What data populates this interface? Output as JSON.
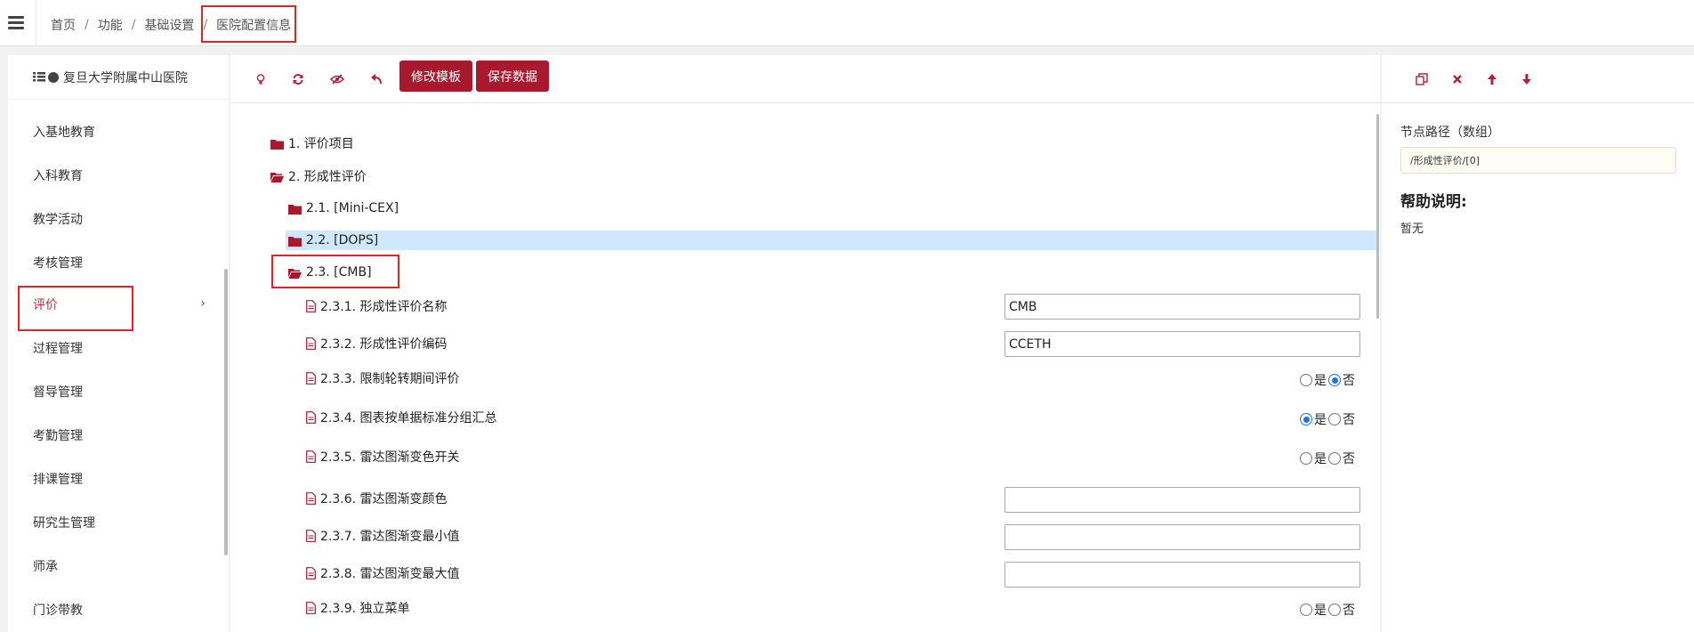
{
  "breadcrumb": {
    "home": "首页",
    "func": "功能",
    "basic": "基础设置",
    "current": "医院配置信息",
    "separator": "/"
  },
  "sidebar": {
    "hospital_name": "复旦大学附属中山医院",
    "items": [
      {
        "label": "入基地教育"
      },
      {
        "label": "入科教育"
      },
      {
        "label": "教学活动"
      },
      {
        "label": "考核管理"
      },
      {
        "label": "评价",
        "chevron": "›"
      },
      {
        "label": "过程管理"
      },
      {
        "label": "督导管理"
      },
      {
        "label": "考勤管理"
      },
      {
        "label": "排课管理"
      },
      {
        "label": "研究生管理"
      },
      {
        "label": "师承"
      },
      {
        "label": "门诊带教"
      }
    ]
  },
  "toolbar": {
    "icons": [
      "lightbulb-icon",
      "refresh-icon",
      "eye-slash-icon",
      "undo-icon"
    ],
    "edit_template_label": "修改模板",
    "save_data_label": "保存数据"
  },
  "tree": {
    "n1": "1. 评价项目",
    "n2": "2. 形成性评价",
    "n21": "2.1. [Mini-CEX]",
    "n22": "2.2. [DOPS]",
    "n23": "2.3. [CMB]",
    "leaves": [
      {
        "label": "2.3.1. 形成性评价名称",
        "value": "CMB"
      },
      {
        "label": "2.3.2. 形成性评价编码",
        "value": "CCETH"
      },
      {
        "label": "2.3.3. 限制轮转期间评价"
      },
      {
        "label": "2.3.4. 图表按单据标准分组汇总"
      },
      {
        "label": "2.3.5. 雷达图渐变色开关"
      },
      {
        "label": "2.3.6. 雷达图渐变颜色",
        "value": ""
      },
      {
        "label": "2.3.7. 雷达图渐变最小值",
        "value": ""
      },
      {
        "label": "2.3.8. 雷达图渐变最大值",
        "value": ""
      },
      {
        "label": "2.3.9. 独立菜单"
      }
    ],
    "yes_label": "是",
    "no_label": "否"
  },
  "right_panel": {
    "icons": [
      "copy-icon",
      "delete-icon",
      "arrow-up-icon",
      "arrow-down-icon"
    ],
    "path_label": "节点路径（数组）",
    "path_value": "/形成性评价/[0]",
    "help_title": "帮助说明:",
    "help_text": "暂无"
  },
  "colors": {
    "accent": "#a8192e",
    "active_text": "#c5283d",
    "radio_checked": "#1a73e8",
    "selected_row": "#cfe8fb",
    "highlight_box": "#e02424"
  }
}
